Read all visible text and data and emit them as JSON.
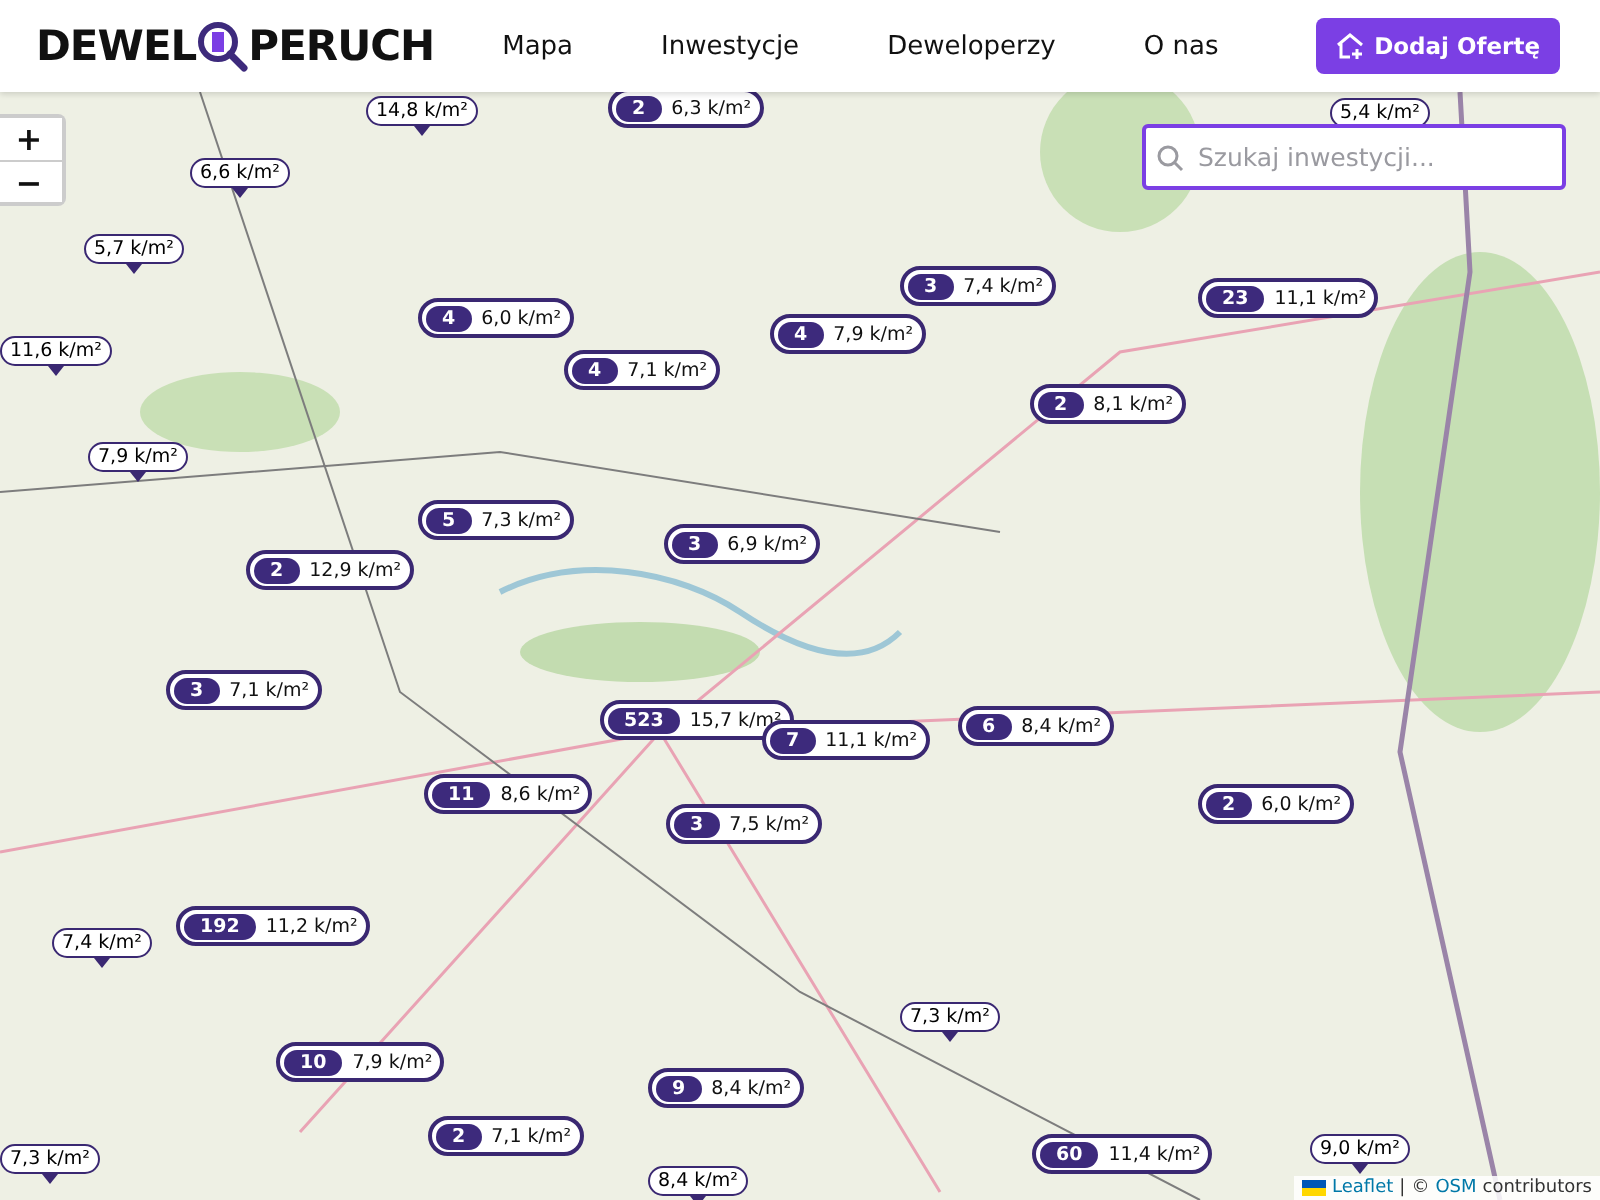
{
  "header": {
    "logo": {
      "left": "DEWEL",
      "right": "PERUCH"
    },
    "nav": [
      {
        "label": "Mapa"
      },
      {
        "label": "Inwestycje"
      },
      {
        "label": "Deweloperzy"
      },
      {
        "label": "O nas"
      }
    ],
    "cta": "Dodaj Ofertę"
  },
  "map": {
    "zoom_in": "+",
    "zoom_out": "−",
    "search": {
      "placeholder": "Szukaj inwestycji..."
    },
    "markers": [
      {
        "kind": "single",
        "price": "14,8 k/m²"
      },
      {
        "kind": "cluster",
        "count": "2",
        "price": "6,3 k/m²"
      },
      {
        "kind": "single",
        "price": "5,4 k/m²"
      },
      {
        "kind": "single",
        "price": "6,6 k/m²"
      },
      {
        "kind": "single",
        "price": "5,7 k/m²"
      },
      {
        "kind": "cluster",
        "count": "4",
        "price": "6,0 k/m²"
      },
      {
        "kind": "cluster",
        "count": "3",
        "price": "7,4 k/m²"
      },
      {
        "kind": "cluster",
        "count": "23",
        "price": "11,1 k/m²"
      },
      {
        "kind": "cluster",
        "count": "4",
        "price": "7,9 k/m²"
      },
      {
        "kind": "cluster",
        "count": "4",
        "price": "7,1 k/m²"
      },
      {
        "kind": "single",
        "price": "11,6 k/m²"
      },
      {
        "kind": "cluster",
        "count": "2",
        "price": "8,1 k/m²"
      },
      {
        "kind": "single",
        "price": "7,9 k/m²"
      },
      {
        "kind": "cluster",
        "count": "5",
        "price": "7,3 k/m²"
      },
      {
        "kind": "cluster",
        "count": "3",
        "price": "6,9 k/m²"
      },
      {
        "kind": "cluster",
        "count": "2",
        "price": "12,9 k/m²"
      },
      {
        "kind": "cluster",
        "count": "3",
        "price": "7,1 k/m²"
      },
      {
        "kind": "cluster",
        "count": "523",
        "price": "15,7 k/m²"
      },
      {
        "kind": "cluster",
        "count": "7",
        "price": "11,1 k/m²"
      },
      {
        "kind": "cluster",
        "count": "6",
        "price": "8,4 k/m²"
      },
      {
        "kind": "cluster",
        "count": "11",
        "price": "8,6 k/m²"
      },
      {
        "kind": "cluster",
        "count": "2",
        "price": "6,0 k/m²"
      },
      {
        "kind": "cluster",
        "count": "3",
        "price": "7,5 k/m²"
      },
      {
        "kind": "cluster",
        "count": "192",
        "price": "11,2 k/m²"
      },
      {
        "kind": "single",
        "price": "7,4 k/m²"
      },
      {
        "kind": "single",
        "price": "7,3 k/m²"
      },
      {
        "kind": "cluster",
        "count": "10",
        "price": "7,9 k/m²"
      },
      {
        "kind": "cluster",
        "count": "9",
        "price": "8,4 k/m²"
      },
      {
        "kind": "cluster",
        "count": "2",
        "price": "7,1 k/m²"
      },
      {
        "kind": "cluster",
        "count": "60",
        "price": "11,4 k/m²"
      },
      {
        "kind": "single",
        "price": "9,0 k/m²"
      },
      {
        "kind": "single",
        "price": "7,3 k/m²"
      },
      {
        "kind": "single",
        "price": "8,4 k/m²"
      }
    ],
    "attribution": {
      "leaflet": "Leaflet",
      "separator": "|",
      "copyright": "©",
      "osm": "OSM",
      "suffix": "contributors"
    }
  }
}
